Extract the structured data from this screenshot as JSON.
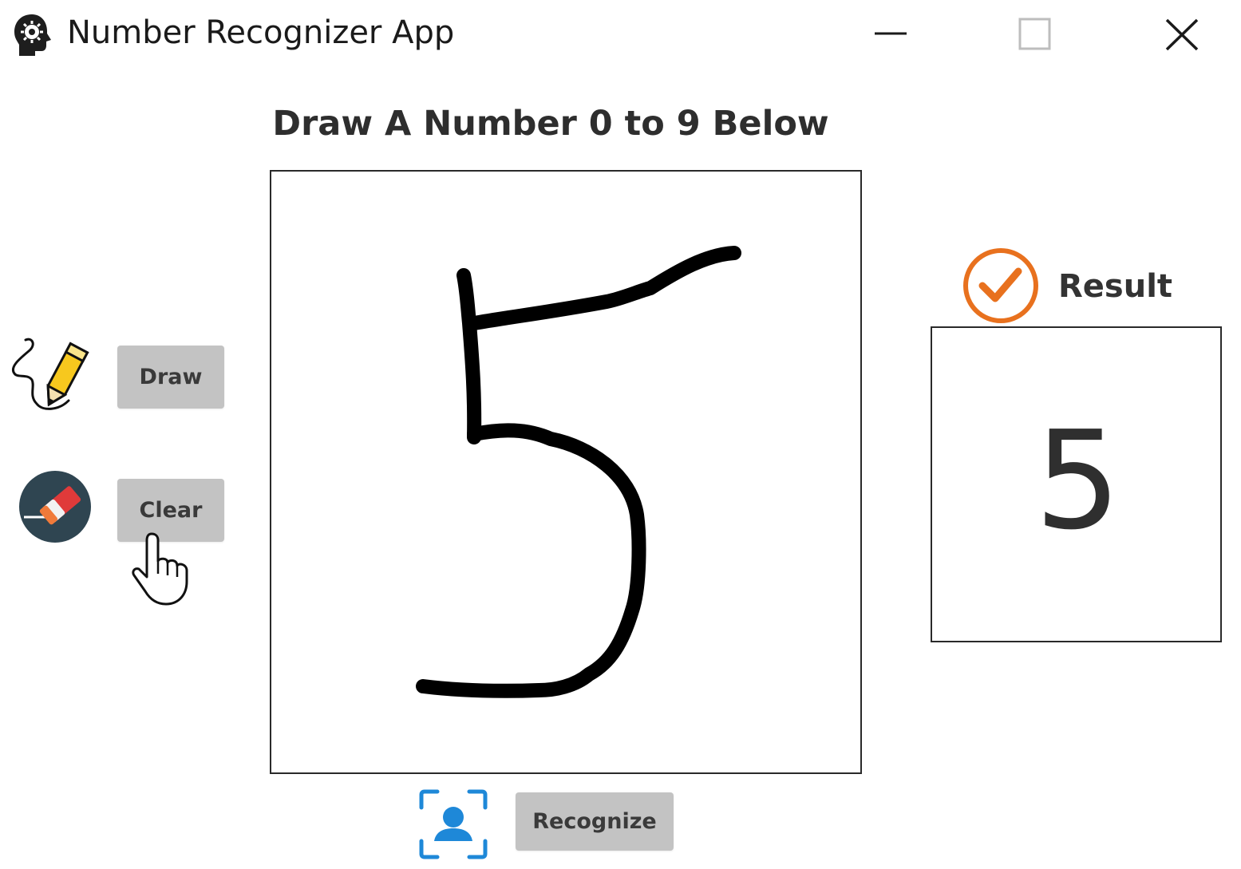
{
  "window": {
    "title": "Number Recognizer App",
    "app_icon": "brain-gear-icon",
    "controls": [
      "minimize-icon",
      "maximize-icon",
      "close-icon"
    ]
  },
  "main": {
    "heading": "Draw A Number 0 to 9 Below",
    "canvas": {
      "drawn_stroke_color": "#000000"
    }
  },
  "toolbar": {
    "draw_label": "Draw",
    "draw_icon": "pencil-icon",
    "clear_label": "Clear",
    "clear_icon": "eraser-icon",
    "recognize_label": "Recognize",
    "recognize_icon": "face-scan-icon"
  },
  "result": {
    "label": "Result",
    "icon": "checkmark-circle-icon",
    "value": "5",
    "accent_color": "#e8711e"
  },
  "colors": {
    "button_bg": "#c3c3c3",
    "scan_icon": "#1e88d8"
  }
}
